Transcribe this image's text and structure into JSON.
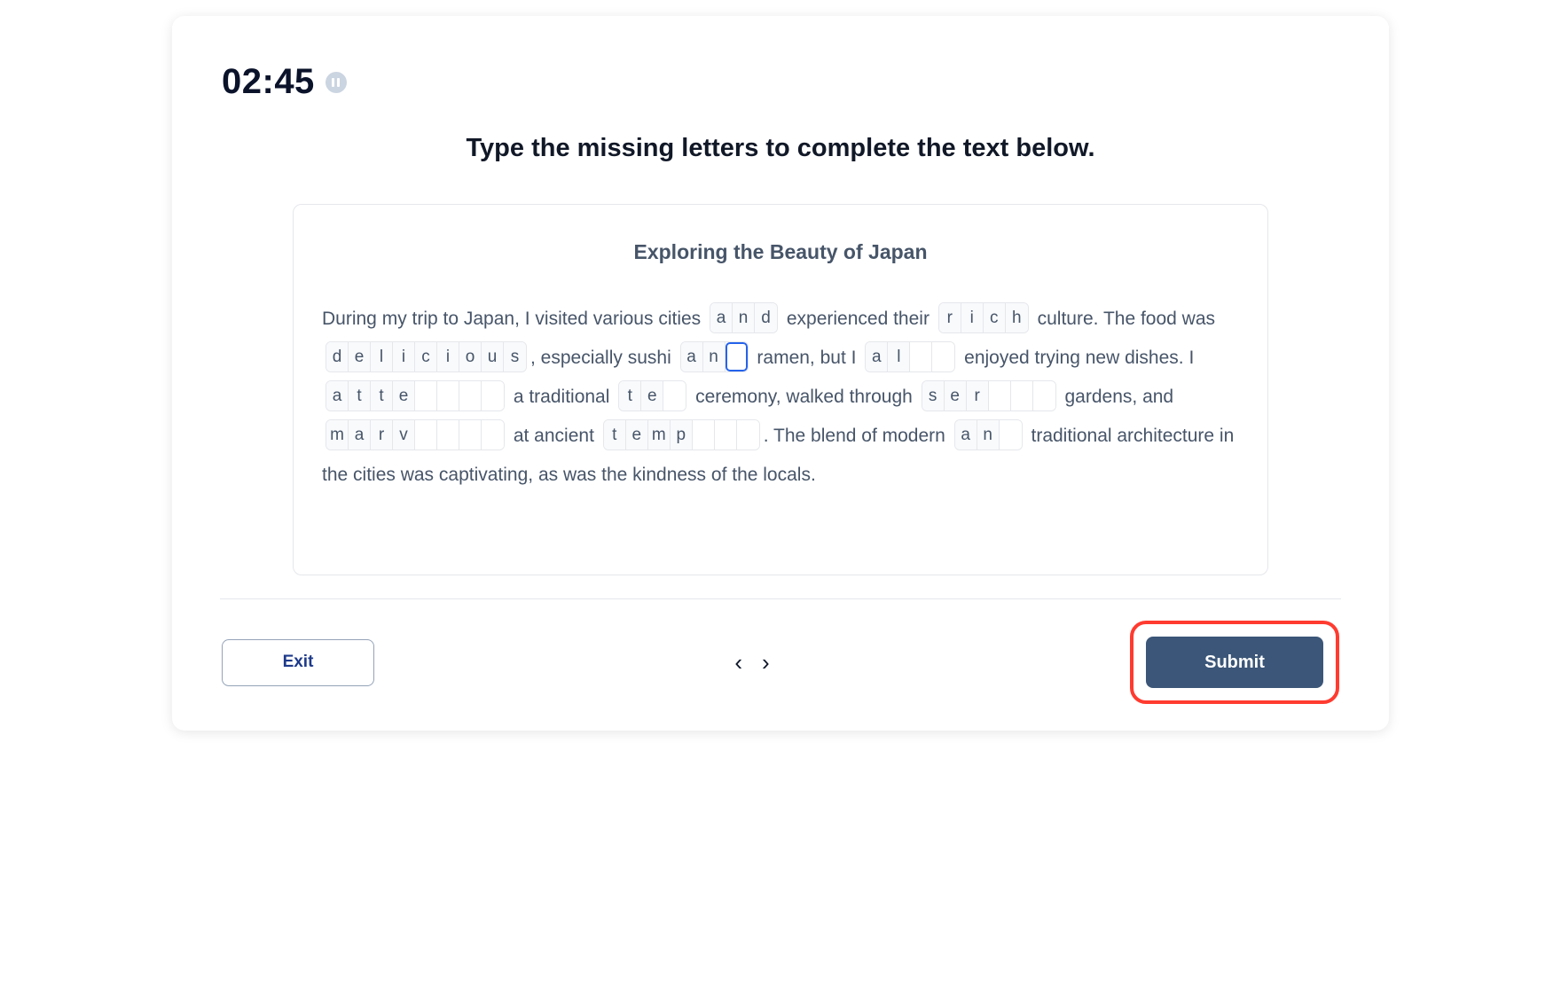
{
  "timer": "02:45",
  "instruction": "Type the missing letters to complete the text below.",
  "panel_title": "Exploring the Beauty of Japan",
  "segments": [
    {
      "t": "text",
      "v": "During my trip to Japan, I visited various cities "
    },
    {
      "t": "word",
      "cells": [
        "a",
        "n",
        "d"
      ],
      "active": -1
    },
    {
      "t": "text",
      "v": " experienced their "
    },
    {
      "t": "word",
      "cells": [
        "r",
        "i",
        "c",
        "h"
      ],
      "active": -1
    },
    {
      "t": "text",
      "v": " culture. The food was "
    },
    {
      "t": "word",
      "cells": [
        "d",
        "e",
        "l",
        "i",
        "c",
        "i",
        "o",
        "u",
        "s"
      ],
      "active": -1
    },
    {
      "t": "text",
      "v": ", especially sushi "
    },
    {
      "t": "word",
      "cells": [
        "a",
        "n",
        ""
      ],
      "active": 2
    },
    {
      "t": "text",
      "v": " ramen, but I "
    },
    {
      "t": "word",
      "cells": [
        "a",
        "l",
        "",
        ""
      ],
      "active": -1
    },
    {
      "t": "text",
      "v": " enjoyed trying new dishes. I "
    },
    {
      "t": "word",
      "cells": [
        "a",
        "t",
        "t",
        "e",
        "",
        "",
        "",
        ""
      ],
      "active": -1
    },
    {
      "t": "text",
      "v": " a traditional "
    },
    {
      "t": "word",
      "cells": [
        "t",
        "e",
        ""
      ],
      "active": -1
    },
    {
      "t": "text",
      "v": " ceremony, walked through "
    },
    {
      "t": "word",
      "cells": [
        "s",
        "e",
        "r",
        "",
        "",
        ""
      ],
      "active": -1
    },
    {
      "t": "text",
      "v": " gardens, and "
    },
    {
      "t": "word",
      "cells": [
        "m",
        "a",
        "r",
        "v",
        "",
        "",
        "",
        ""
      ],
      "active": -1
    },
    {
      "t": "text",
      "v": " at ancient "
    },
    {
      "t": "word",
      "cells": [
        "t",
        "e",
        "m",
        "p",
        "",
        "",
        ""
      ],
      "active": -1
    },
    {
      "t": "text",
      "v": ". The blend of modern "
    },
    {
      "t": "word",
      "cells": [
        "a",
        "n",
        ""
      ],
      "active": -1
    },
    {
      "t": "text",
      "v": " traditional architecture in the cities was captivating, as was the kindness of the locals."
    }
  ],
  "buttons": {
    "exit": "Exit",
    "submit": "Submit"
  }
}
